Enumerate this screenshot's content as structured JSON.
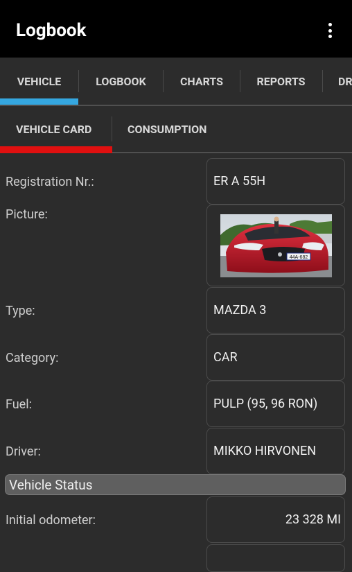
{
  "app": {
    "title": "Logbook",
    "menu_icon": "more-vert-icon"
  },
  "tabs": [
    {
      "label": "VEHICLE",
      "selected": true
    },
    {
      "label": "LOGBOOK"
    },
    {
      "label": "CHARTS"
    },
    {
      "label": "REPORTS"
    },
    {
      "label": "DR"
    }
  ],
  "subtabs": [
    {
      "label": "VEHICLE CARD",
      "selected": true
    },
    {
      "label": "CONSUMPTION"
    }
  ],
  "colors": {
    "tab_accent": "#35a7e0",
    "subtab_accent": "#e01010"
  },
  "fields": {
    "registration": {
      "label": "Registration Nr.:",
      "value": "ER A 55H"
    },
    "picture": {
      "label": "Picture:",
      "plate_text": "44A-682"
    },
    "type": {
      "label": "Type:",
      "value": "MAZDA 3"
    },
    "category": {
      "label": "Category:",
      "value": "CAR"
    },
    "fuel": {
      "label": "Fuel:",
      "value": "PULP (95, 96 RON)"
    },
    "driver": {
      "label": "Driver:",
      "value": "MIKKO HIRVONEN"
    }
  },
  "section": {
    "title": "Vehicle Status"
  },
  "status": {
    "initial_odometer": {
      "label": "Initial odometer:",
      "value": "23 328 MI"
    }
  }
}
